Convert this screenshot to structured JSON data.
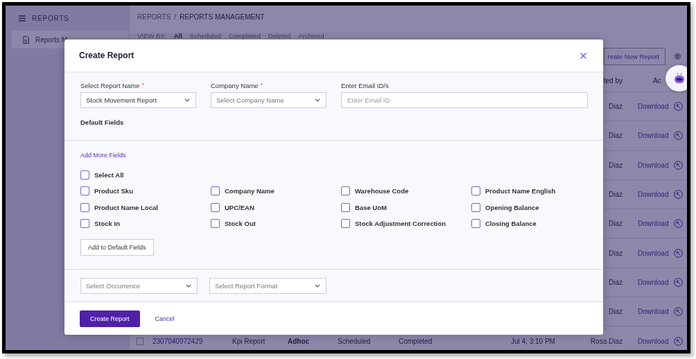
{
  "sidebar": {
    "title": "REPORTS",
    "items": [
      {
        "label": "Reports M",
        "selected": true
      }
    ]
  },
  "breadcrumb": {
    "items": [
      "REPORTS",
      "REPORTS MANAGEMENT"
    ],
    "separator": "/"
  },
  "view_by": {
    "label": "VIEW BY:",
    "tabs": [
      {
        "label": "All",
        "selected": true
      },
      {
        "label": "Scheduled",
        "selected": false
      },
      {
        "label": "Completed",
        "selected": false
      },
      {
        "label": "Deleted",
        "selected": false
      },
      {
        "label": "Archived",
        "selected": false
      }
    ]
  },
  "toolbar": {
    "create_button": "reate New Report"
  },
  "table": {
    "header": {
      "created_by": "ted by",
      "action": "Ac"
    },
    "rows": [
      {
        "created_by": "Diaz",
        "action": "Download"
      },
      {
        "created_by": "Diaz",
        "action": "Download"
      },
      {
        "created_by": "Diaz",
        "action": "Download"
      },
      {
        "created_by": "Diaz",
        "action": "Download"
      },
      {
        "created_by": "Diaz",
        "action": "Download"
      },
      {
        "created_by": "Diaz",
        "action": "Download"
      },
      {
        "created_by": "Diaz",
        "action": "Download"
      },
      {
        "created_by": "Diaz",
        "action": "Download"
      },
      {
        "checked": false,
        "id": "2307040972429",
        "report_name": "Kpi Report",
        "type": "Adhoc",
        "schedule": "Scheduled",
        "status": "Completed",
        "created_at": "Jul 4, 3:10 PM",
        "created_by": "Rosa Diaz",
        "action": "Download"
      }
    ]
  },
  "modal": {
    "title": "Create Report",
    "fields": [
      {
        "kind": "select",
        "label": "Select Report Name",
        "required_mark": "*",
        "value": "Stock Movement Report"
      },
      {
        "kind": "select",
        "label": "Company Name",
        "required_mark": "*",
        "placeholder": "Select Company Name"
      },
      {
        "kind": "input",
        "label": "Enter Email ID/s",
        "placeholder": "Enter Email ID"
      }
    ],
    "default_fields_label": "Default Fields",
    "add_more_label": "Add More Fields",
    "select_all": {
      "label": "Select All",
      "checked": false
    },
    "options": [
      {
        "label": "Product Sku",
        "checked": false
      },
      {
        "label": "Company Name",
        "checked": false
      },
      {
        "label": "Warehouse Code",
        "checked": false
      },
      {
        "label": "Product Name English",
        "checked": false
      },
      {
        "label": "Product Name Local",
        "checked": false
      },
      {
        "label": "UPC/EAN",
        "checked": false
      },
      {
        "label": "Base UoM",
        "checked": false
      },
      {
        "label": "Opening Balance",
        "checked": false
      },
      {
        "label": "Stock In",
        "checked": false
      },
      {
        "label": "Stock Out",
        "checked": false
      },
      {
        "label": "Stock Adjustment Correction",
        "checked": false
      },
      {
        "label": "Closing Balance",
        "checked": false
      }
    ],
    "add_button": "Add to Default Fields",
    "bottom_selects": [
      {
        "placeholder": "Select Occurrence"
      },
      {
        "placeholder": "Select Report Format"
      }
    ],
    "primary_button": "Create Report",
    "cancel_link": "Cancel"
  }
}
